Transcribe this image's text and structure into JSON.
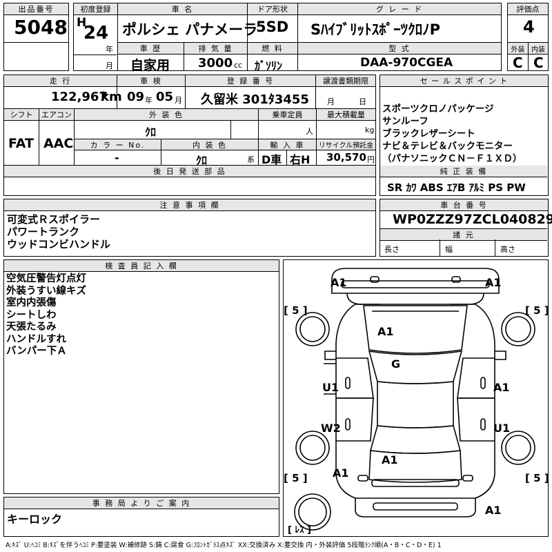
{
  "header": {
    "lot_label": "出品番号",
    "lot_no": "5048",
    "first_reg_label": "初度登録",
    "era": "H",
    "first_reg_year": "24",
    "year_unit": "年",
    "month_unit": "月",
    "car_name_label": "車 名",
    "car_name": "ポルシェ パナメーラ",
    "door_label": "ドア形状",
    "door": "5SD",
    "grade_label": "グ レ ー ド",
    "grade": "Sハイブリットスポーツクロノパッケージ",
    "grade_display": "SﾊｲﾌﾞﾘｯﾄｽﾎﾟｰﾂｸﾛﾉP",
    "score_label": "評価点",
    "score": "4",
    "history_label": "車 歴",
    "history": "自家用",
    "displacement_label": "排 気 量",
    "displacement": "3000",
    "cc": "cc",
    "fuel_label": "燃 料",
    "fuel": "ｶﾞｿﾘﾝ",
    "model_label": "型 式",
    "model": "DAA-970CGEA",
    "ext_label": "外装",
    "ext_grade": "C",
    "int_label": "内装",
    "int_grade": "C"
  },
  "row2": {
    "mileage_label": "走 行",
    "mileage": "122,967",
    "km": "km",
    "inspection_label": "車 検",
    "insp_year": "09",
    "insp_month": "05",
    "year_unit": "年",
    "month_unit": "月",
    "reg_no_label": "登 録 番 号",
    "reg_no": "久留米 301ﾀ3455",
    "transfer_label": "譲渡書類期限",
    "transfer_month": "月",
    "transfer_day": "日",
    "shift_label": "シフト",
    "shift": "FAT",
    "ac_label": "エアコン",
    "ac": "AAC",
    "ext_color_label": "外 装 色",
    "ext_color": "ｸﾛ",
    "capacity_label": "乗車定員",
    "capacity_unit": "人",
    "load_label": "最大積載量",
    "load_unit": "kg",
    "color_no_label": "カ ラ ー No.",
    "color_no": "-",
    "int_color_label": "内 装 色",
    "int_color": "ｸﾛ",
    "int_color_unit": "系",
    "import_label": "輸 入 車",
    "import": "D車",
    "steering": "右H",
    "recycle_label": "リサイクル預託金",
    "recycle": "30,570",
    "yen": "円",
    "later_parts_label": "後 日 発 送 部 品"
  },
  "sales_points": {
    "label": "セ ー ル ス ポ イ ン ト",
    "items": [
      "スポーツクロノパッケージ",
      "サンルーフ",
      "ブラックレザーシート",
      "ナビ＆テレビ＆バックモニター",
      "（パナソニックＣＮ－Ｆ１ＸＤ）"
    ]
  },
  "equipment": {
    "label": "純 正 装 備",
    "items": "SR ｶﾜ ABS ｴｱB ｱﾙﾐ PS PW"
  },
  "notes": {
    "label": "注 意 事 項 欄",
    "items": [
      "可変式Ｒスポイラー",
      "パワートランク",
      "ウッドコンビハンドル"
    ]
  },
  "vin": {
    "label": "車 台 番 号",
    "value": "WP0ZZZ97ZCL040829"
  },
  "dims": {
    "label": "諸 元",
    "length": "長さ",
    "width": "幅",
    "height": "高さ"
  },
  "inspector": {
    "label": "検 査 員 記 入 欄",
    "items": [
      "空気圧警告灯点灯",
      "外装うすい線キズ",
      "室内内張傷",
      "シートしわ",
      "天張たるみ",
      "ハンドルすれ",
      "バンパー下Ａ"
    ]
  },
  "office": {
    "label": "事 務 局 よ り ご 案 内",
    "text": "キーロック"
  },
  "diagram": {
    "marks": {
      "fl_corner": "A1",
      "fr_corner": "A1",
      "hood": "A1",
      "roof": "G",
      "l_front_door": "U1",
      "r_front_door": "A1",
      "l_rear_door": "W2",
      "r_rear_door": "U1",
      "trunk": "A1",
      "rl_corner": "A1",
      "rear": "A1"
    },
    "tires": {
      "fl": "5",
      "fr": "5",
      "rl": "5",
      "rr": "5",
      "spare": "ﾚｽ"
    }
  },
  "legend": "A:ｷｽﾞ U:ﾍｺﾐ B:ｷｽﾞを伴うﾍｺﾐ P:要塗装 W:補修跡 S:錆 C:腐食 G:ﾌﾛﾝﾄｶﾞﾗｽ点ｷｽﾞ XX:交換済み X:要交換 内・外装評価 5段階ﾗﾝｸ順(A・B・C・D・E) 1"
}
